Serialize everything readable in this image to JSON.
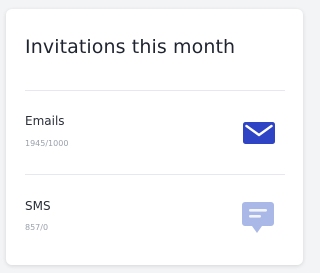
{
  "card": {
    "title": "Invitations this month"
  },
  "rows": [
    {
      "label": "Emails",
      "value": "1945/1000",
      "icon": "envelope-icon",
      "icon_color": "#2f43c5"
    },
    {
      "label": "SMS",
      "value": "857/0",
      "icon": "chat-bubble-icon",
      "icon_color": "#aab8e8"
    }
  ]
}
